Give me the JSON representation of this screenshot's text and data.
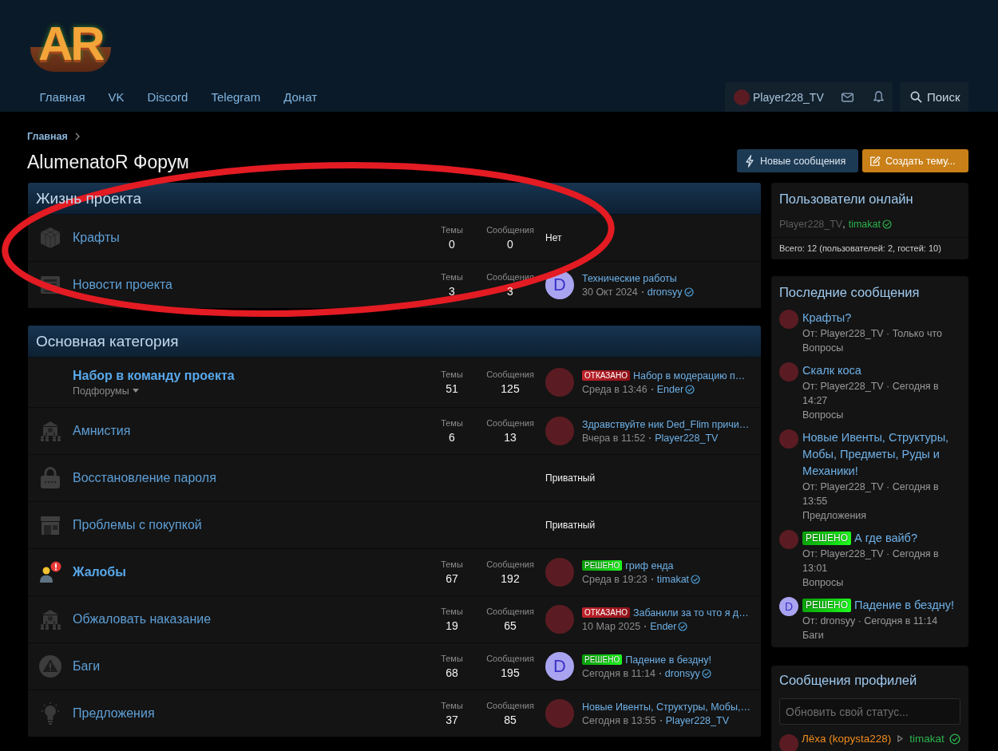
{
  "header": {
    "logo": "AR",
    "nav": [
      {
        "label": "Главная"
      },
      {
        "label": "VK"
      },
      {
        "label": "Discord"
      },
      {
        "label": "Telegram"
      },
      {
        "label": "Донат"
      }
    ],
    "account": {
      "username": "Player228_TV"
    },
    "search": {
      "label": "Поиск"
    }
  },
  "breadcrumb": [
    {
      "label": "Главная"
    }
  ],
  "page_title": "AlumenatoR Форум",
  "actions": [
    {
      "kind": "new",
      "label": "Новые сообщения"
    },
    {
      "kind": "create",
      "label": "Создать тему..."
    }
  ],
  "categories": [
    {
      "title": "Жизнь проекта",
      "forums": [
        {
          "kind": "cube",
          "title": "Крафты",
          "unread": false,
          "stats": [
            {
              "label": "Темы",
              "value": "0"
            },
            {
              "label": "Сообщения",
              "value": "0"
            }
          ],
          "last": {
            "kind": "none",
            "text": "Нет"
          }
        },
        {
          "kind": "newspaper",
          "title": "Новости проекта",
          "unread": false,
          "stats": [
            {
              "label": "Темы",
              "value": "3"
            },
            {
              "label": "Сообщения",
              "value": "3"
            }
          ],
          "last": {
            "kind": "post",
            "avatar": {
              "kind": "letter",
              "letter": "D"
            },
            "title": "Технические работы",
            "date": "30 Окт 2024",
            "author": "dronsyy",
            "verified": true
          }
        }
      ]
    },
    {
      "title": "Основная категория",
      "forums": [
        {
          "kind": "plain",
          "title": "Набор в команду проекта",
          "unread": true,
          "subforums": "Подфорумы",
          "stats": [
            {
              "label": "Темы",
              "value": "51"
            },
            {
              "label": "Сообщения",
              "value": "125"
            }
          ],
          "last": {
            "kind": "post",
            "avatar": {
              "kind": "photo"
            },
            "prefix": {
              "kind": "rejected",
              "label": "ОТКАЗАНО"
            },
            "title": "Набор в модерацию п…",
            "date": "Среда в 13:46",
            "author": "Ender",
            "verified": true
          }
        },
        {
          "kind": "building",
          "title": "Амнистия",
          "unread": false,
          "stats": [
            {
              "label": "Темы",
              "value": "6"
            },
            {
              "label": "Сообщения",
              "value": "13"
            }
          ],
          "last": {
            "kind": "post",
            "avatar": {
              "kind": "photo"
            },
            "title": "Здравствуйте ник Ded_Flim причи…",
            "date": "Вчера в 11:52",
            "author": "Player228_TV"
          }
        },
        {
          "kind": "lock",
          "title": "Восстановление пароля",
          "unread": false,
          "last": {
            "kind": "private",
            "text": "Приватный"
          }
        },
        {
          "kind": "store",
          "title": "Проблемы с покупкой",
          "unread": false,
          "last": {
            "kind": "private",
            "text": "Приватный"
          }
        },
        {
          "kind": "user-alert",
          "title": "Жалобы",
          "unread": true,
          "stats": [
            {
              "label": "Темы",
              "value": "67"
            },
            {
              "label": "Сообщения",
              "value": "192"
            }
          ],
          "last": {
            "kind": "post",
            "avatar": {
              "kind": "photo"
            },
            "prefix": {
              "kind": "solved",
              "label": "РЕШЕНО"
            },
            "title": "гриф енда",
            "date": "Среда в 19:23",
            "author": "timakat",
            "verified": true
          }
        },
        {
          "kind": "building",
          "title": "Обжаловать наказание",
          "unread": false,
          "stats": [
            {
              "label": "Темы",
              "value": "19"
            },
            {
              "label": "Сообщения",
              "value": "65"
            }
          ],
          "last": {
            "kind": "post",
            "avatar": {
              "kind": "photo"
            },
            "prefix": {
              "kind": "rejected",
              "label": "ОТКАЗАНО"
            },
            "title": "Забанили за то что я д…",
            "date": "10 Мар 2025",
            "author": "Ender",
            "verified": true
          }
        },
        {
          "kind": "warning",
          "title": "Баги",
          "unread": false,
          "stats": [
            {
              "label": "Темы",
              "value": "68"
            },
            {
              "label": "Сообщения",
              "value": "195"
            }
          ],
          "last": {
            "kind": "post",
            "avatar": {
              "kind": "letter",
              "letter": "D"
            },
            "prefix": {
              "kind": "solved",
              "label": "РЕШЕНО"
            },
            "title": "Падение в бездну!",
            "date": "Сегодня в 11:14",
            "author": "dronsyy",
            "verified": true
          }
        },
        {
          "kind": "lightbulb",
          "title": "Предложения",
          "unread": false,
          "stats": [
            {
              "label": "Темы",
              "value": "37"
            },
            {
              "label": "Сообщения",
              "value": "85"
            }
          ],
          "last": {
            "kind": "post",
            "avatar": {
              "kind": "photo"
            },
            "title": "Новые Ивенты, Структуры, Мобы,…",
            "date": "Сегодня в 13:55",
            "author": "Player228_TV"
          }
        }
      ]
    }
  ],
  "sidebar": {
    "online": {
      "title": "Пользователи онлайн",
      "separator": ",",
      "users": [
        {
          "name": "Player228_TV",
          "color": "#5c5c5c"
        },
        {
          "name": "timakat",
          "color": "#2bb24c",
          "verified": true
        }
      ],
      "total": "Всего: 12 (пользователей: 2, гостей: 10)"
    },
    "latest": {
      "title": "Последние сообщения",
      "items": [
        {
          "avatar": {
            "kind": "photo"
          },
          "title": "Крафты?",
          "meta": "От: Player228_TV · Только что",
          "forum": "Вопросы"
        },
        {
          "avatar": {
            "kind": "photo"
          },
          "title": "Скалк коса",
          "meta": "От: Player228_TV · Сегодня в 14:27",
          "forum": "Вопросы"
        },
        {
          "avatar": {
            "kind": "photo"
          },
          "title": "Новые Ивенты, Структуры, Мобы, Предметы, Руды и Механики!",
          "meta": "От: Player228_TV · Сегодня в 13:55",
          "forum": "Предложения"
        },
        {
          "avatar": {
            "kind": "photo"
          },
          "prefix": {
            "kind": "solved",
            "label": "РЕШЕНО"
          },
          "title": "А где вайб?",
          "meta": "От: Player228_TV · Сегодня в 13:01",
          "forum": "Вопросы"
        },
        {
          "avatar": {
            "kind": "letter",
            "letter": "D"
          },
          "prefix": {
            "kind": "solved",
            "label": "РЕШЕНО"
          },
          "title": "Падение в бездну!",
          "meta": "От: dronsyy · Сегодня в 11:14",
          "forum": "Баги"
        }
      ]
    },
    "profile_posts": {
      "title": "Сообщения профилей",
      "input": {
        "placeholder": "Обновить свой статус..."
      },
      "items": [
        {
          "avatar": {
            "kind": "photo"
          },
          "author": {
            "name": "Лёха (kopysta228)",
            "color": "#f08c1e"
          },
          "target": {
            "name": "timakat",
            "color": "#2bb24c",
            "verified": true
          }
        }
      ]
    }
  },
  "annotations": [
    {
      "kind": "ellipse"
    }
  ]
}
